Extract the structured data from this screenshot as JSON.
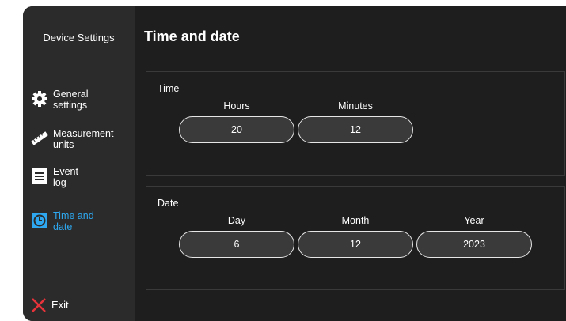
{
  "sidebar": {
    "title": "Device Settings",
    "items": [
      {
        "label_line1": "General",
        "label_line2": "settings",
        "icon": "gear-icon"
      },
      {
        "label_line1": "Measurement",
        "label_line2": "units",
        "icon": "ruler-icon"
      },
      {
        "label_line1": "Event",
        "label_line2": "log",
        "icon": "list-icon"
      },
      {
        "label_line1": "Time and",
        "label_line2": "date",
        "icon": "clock-icon",
        "active": true
      }
    ],
    "exit_label": "Exit"
  },
  "main": {
    "title": "Time and date",
    "time": {
      "label": "Time",
      "hours_label": "Hours",
      "hours_value": "20",
      "minutes_label": "Minutes",
      "minutes_value": "12"
    },
    "date": {
      "label": "Date",
      "day_label": "Day",
      "day_value": "6",
      "month_label": "Month",
      "month_value": "12",
      "year_label": "Year",
      "year_value": "2023"
    }
  },
  "colors": {
    "accent": "#2ea8f0",
    "exit_icon": "#e8333a",
    "sidebar_bg": "#2b2b2b",
    "main_bg": "#1e1e1e"
  }
}
